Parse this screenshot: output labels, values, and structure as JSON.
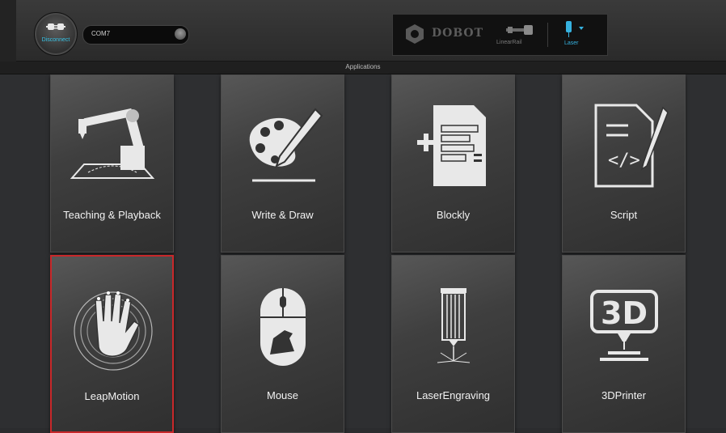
{
  "toolbar": {
    "connect_label": "Disconnect",
    "port_value": "COM7",
    "brand_name": "DOBOT",
    "linear_rail_label": "LinearRail",
    "laser_label": "Laser"
  },
  "section": {
    "title": "Applications"
  },
  "apps": [
    {
      "label": "Teaching & Playback",
      "icon": "robot-arm-icon"
    },
    {
      "label": "Write & Draw",
      "icon": "palette-pencil-icon"
    },
    {
      "label": "Blockly",
      "icon": "blockly-document-icon"
    },
    {
      "label": "Script",
      "icon": "script-document-icon"
    },
    {
      "label": "LeapMotion",
      "icon": "hand-icon",
      "selected": true
    },
    {
      "label": "Mouse",
      "icon": "mouse-icon"
    },
    {
      "label": "LaserEngraving",
      "icon": "laser-engraver-icon"
    },
    {
      "label": "3DPrinter",
      "icon": "3d-printer-icon"
    }
  ],
  "colors": {
    "accent_blue": "#36c3e6",
    "selected_border": "#c8282a"
  }
}
